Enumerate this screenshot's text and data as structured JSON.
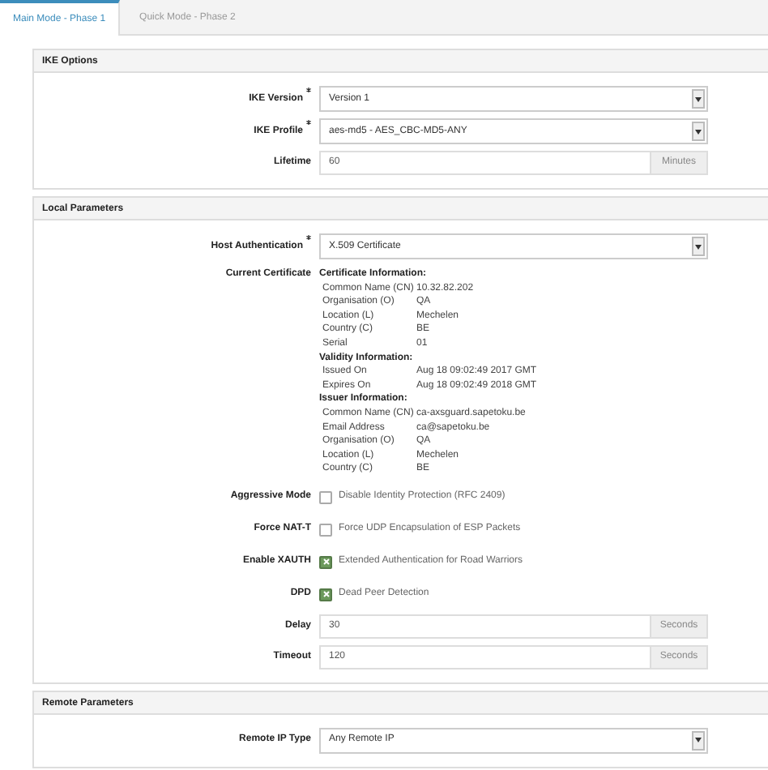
{
  "tabs": [
    {
      "label": "Main Mode - Phase 1",
      "selected": true
    },
    {
      "label": "Quick Mode - Phase 2",
      "selected": false
    }
  ],
  "sections": [
    {
      "title": "IKE Options",
      "fields": [
        {
          "kind": "select",
          "label": "IKE Version",
          "required": true,
          "value": "Version 1"
        },
        {
          "kind": "select",
          "label": "IKE Profile",
          "required": true,
          "value": "aes-md5 - AES_CBC-MD5-ANY"
        },
        {
          "kind": "input",
          "label": "Lifetime",
          "value": "60",
          "unit": "Minutes"
        }
      ]
    },
    {
      "title": "Local Parameters",
      "fields": [
        {
          "kind": "select",
          "label": "Host Authentication",
          "required": true,
          "value": "X.509 Certificate"
        },
        {
          "kind": "certificate",
          "label": "Current Certificate",
          "groups": [
            {
              "title": "Certificate Information:",
              "rows": [
                {
                  "name": "Common Name (CN)",
                  "value": "10.32.82.202"
                },
                {
                  "name": "Organisation (O)",
                  "value": "QA"
                },
                {
                  "name": "Location (L)",
                  "value": "Mechelen"
                },
                {
                  "name": "Country (C)",
                  "value": "BE"
                },
                {
                  "name": "Serial",
                  "value": "01"
                }
              ]
            },
            {
              "title": "Validity Information:",
              "rows": [
                {
                  "name": "Issued On",
                  "value": "Aug 18 09:02:49 2017 GMT"
                },
                {
                  "name": "Expires On",
                  "value": "Aug 18 09:02:49 2018 GMT"
                }
              ]
            },
            {
              "title": "Issuer Information:",
              "rows": [
                {
                  "name": "Common Name (CN)",
                  "value": "ca-axsguard.sapetoku.be"
                },
                {
                  "name": "Email Address",
                  "value": "ca@sapetoku.be"
                },
                {
                  "name": "Organisation (O)",
                  "value": "QA"
                },
                {
                  "name": "Location (L)",
                  "value": "Mechelen"
                },
                {
                  "name": "Country (C)",
                  "value": "BE"
                }
              ]
            }
          ]
        },
        {
          "kind": "checkbox",
          "label": "Aggressive Mode",
          "text": "Disable Identity Protection (RFC 2409)",
          "checked": false
        },
        {
          "kind": "checkbox",
          "label": "Force NAT-T",
          "text": "Force UDP Encapsulation of ESP Packets",
          "checked": false
        },
        {
          "kind": "checkbox",
          "label": "Enable XAUTH",
          "text": "Extended Authentication for Road Warriors",
          "checked": true
        },
        {
          "kind": "checkbox",
          "label": "DPD",
          "text": "Dead Peer Detection",
          "checked": true
        },
        {
          "kind": "input",
          "label": "Delay",
          "value": "30",
          "unit": "Seconds"
        },
        {
          "kind": "input",
          "label": "Timeout",
          "value": "120",
          "unit": "Seconds"
        }
      ]
    },
    {
      "title": "Remote Parameters",
      "fields": [
        {
          "kind": "select",
          "label": "Remote IP Type",
          "required": false,
          "value": "Any Remote IP"
        }
      ]
    }
  ]
}
